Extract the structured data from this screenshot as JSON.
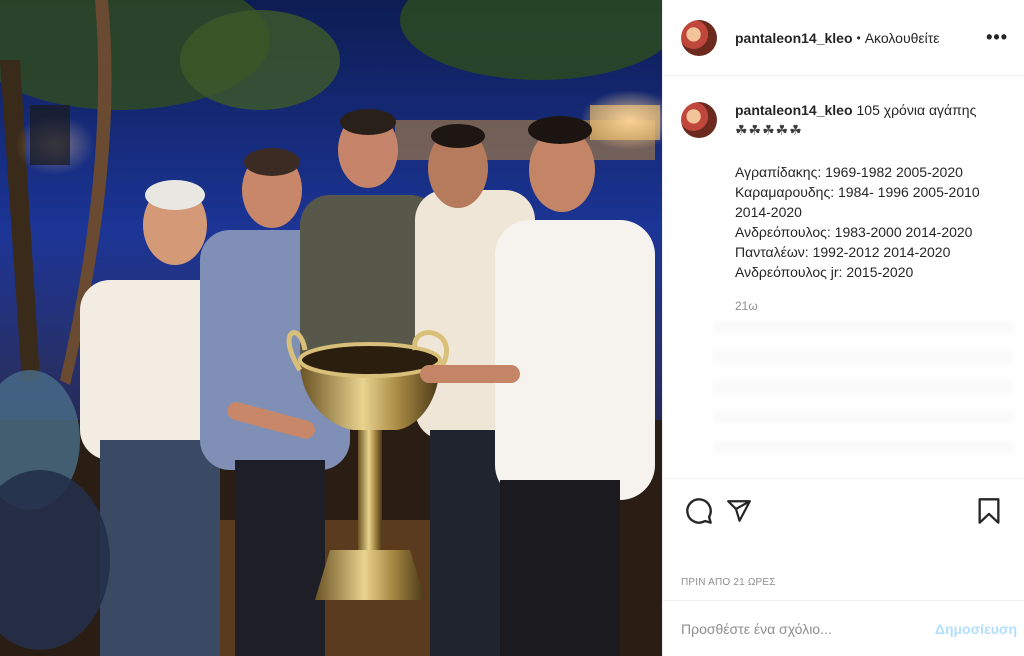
{
  "post": {
    "image_alt": "Group photo of five men holding a trophy at night",
    "author": {
      "username": "pantaleon14_kleo",
      "follow_status": "Ακολουθείτε",
      "more_label": "•••"
    },
    "caption": {
      "username": "pantaleon14_kleo",
      "text": "105 χρόνια αγάπης",
      "symbols": "☘☘☘☘☘",
      "lines": [
        "Αγραπίδακης: 1969-1982 2005-2020",
        "Καραμαρουδης: 1984- 1996 2005-2010 2014-2020",
        "Ανδρεόπουλος: 1983-2000 2014-2020",
        "Πανταλέων: 1992-2012 2014-2020",
        "Ανδρεόπουλος jr: 2015-2020"
      ],
      "time_ago": "21ω"
    },
    "actions": {
      "comment_icon": "comment-icon",
      "share_icon": "share-icon",
      "save_icon": "bookmark-icon"
    },
    "timestamp": "ΠΡΙΝ ΑΠΟ 21 ΩΡΕΣ",
    "comment_box": {
      "placeholder": "Προσθέστε ένα σχόλιο...",
      "publish_label": "Δημοσίευση"
    }
  }
}
